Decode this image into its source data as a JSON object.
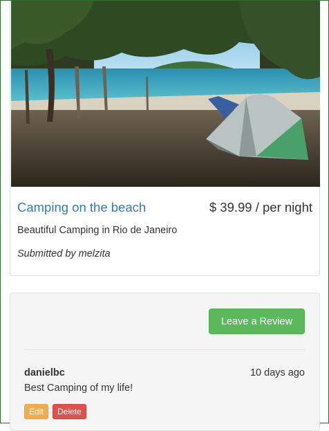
{
  "campground": {
    "image_alt": "Tent on a shaded beach with turquoise water",
    "name": "Camping on the beach",
    "price": "$ 39.99 / per night",
    "description": "Beautiful Camping in Rio de Janeiro",
    "submitted_by": "Submitted by melzita"
  },
  "reviews": {
    "leave_review_label": "Leave a Review",
    "items": [
      {
        "author": "danielbc",
        "time_ago": "10 days ago",
        "text": "Best Camping of my life!",
        "edit_label": "Edit",
        "delete_label": "Delete"
      }
    ]
  },
  "colors": {
    "title_link": "#337ab7",
    "review_button": "#5cb85c",
    "edit_button": "#f0ad4e",
    "delete_button": "#d9534f"
  }
}
